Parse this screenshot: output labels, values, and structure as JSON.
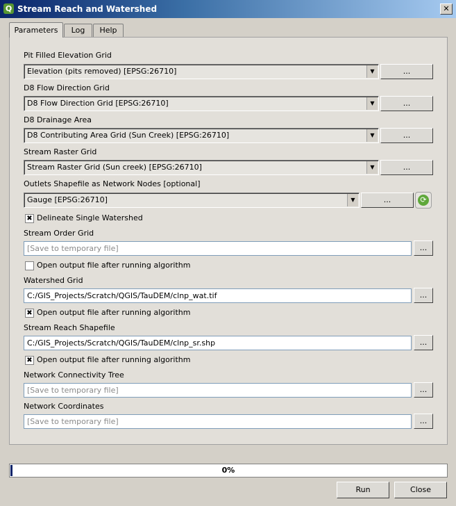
{
  "window": {
    "title": "Stream Reach and Watershed",
    "app_icon": "Q",
    "close_glyph": "✕"
  },
  "tabs": [
    "Parameters",
    "Log",
    "Help"
  ],
  "params": {
    "pit_label": "Pit Filled Elevation Grid",
    "pit_value": "Elevation (pits removed) [EPSG:26710]",
    "d8_label": "D8 Flow Direction Grid",
    "d8_value": "D8 Flow Direction Grid [EPSG:26710]",
    "drain_label": "D8 Drainage Area",
    "drain_value": "D8 Contributing Area Grid (Sun Creek) [EPSG:26710]",
    "stream_raster_label": "Stream Raster Grid",
    "stream_raster_value": "Stream Raster Grid (Sun creek) [EPSG:26710]",
    "outlets_label": "Outlets Shapefile as Network Nodes [optional]",
    "outlets_value": "Gauge [EPSG:26710]",
    "delineate_label": "Delineate Single Watershed",
    "delineate_checked": true,
    "stream_order_label": "Stream Order Grid",
    "stream_order_placeholder": "[Save to temporary file]",
    "stream_order_open_label": "Open output file after running algorithm",
    "stream_order_open_checked": false,
    "watershed_label": "Watershed Grid",
    "watershed_value": "C:/GIS_Projects/Scratch/QGIS/TauDEM/clnp_wat.tif",
    "watershed_open_label": "Open output file after running algorithm",
    "watershed_open_checked": true,
    "reach_label": "Stream Reach Shapefile",
    "reach_value": "C:/GIS_Projects/Scratch/QGIS/TauDEM/clnp_sr.shp",
    "reach_open_label": "Open output file after running algorithm",
    "reach_open_checked": true,
    "tree_label": "Network Connectivity Tree",
    "tree_placeholder": "[Save to temporary file]",
    "coords_label": "Network Coordinates",
    "coords_placeholder": "[Save to temporary file]"
  },
  "browse_label": "...",
  "check_glyph": "✖",
  "arrow_glyph": "▼",
  "refresh_glyph": "⟳",
  "progress": {
    "value": 0,
    "label": "0%"
  },
  "buttons": {
    "run": "Run",
    "close": "Close"
  },
  "icons": {
    "refresh": "refresh-icon",
    "app": "qgis-icon"
  }
}
